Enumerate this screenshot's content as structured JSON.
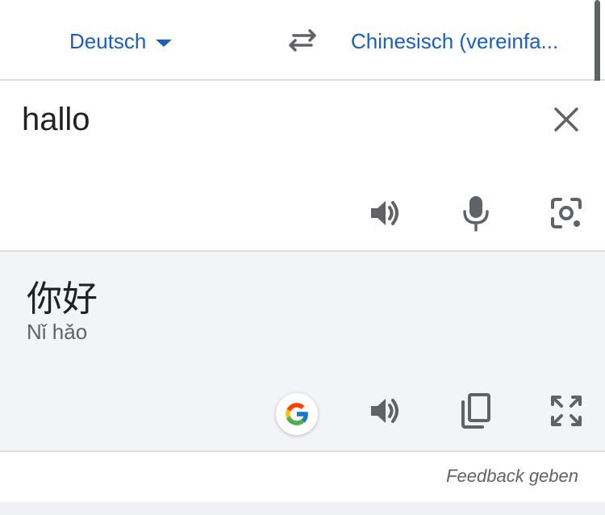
{
  "language_bar": {
    "source_language": "Deutsch",
    "target_language": "Chinesisch (vereinfa..."
  },
  "input": {
    "text": "hallo"
  },
  "result": {
    "translation": "你好",
    "romanization": "Nǐ hǎo"
  },
  "footer": {
    "feedback_label": "Feedback geben"
  },
  "colors": {
    "accent": "#1a5fc0",
    "icon": "#5f6368",
    "result_bg": "#f2f4f8",
    "divider": "#dadce0"
  },
  "icons": {
    "caret": "caret-down-icon",
    "swap": "swap-icon",
    "clear": "close-icon",
    "speaker": "speaker-icon",
    "mic": "microphone-icon",
    "camera": "camera-lens-icon",
    "google": "google-g-icon",
    "copy": "copy-icon",
    "fullscreen": "fullscreen-icon"
  }
}
